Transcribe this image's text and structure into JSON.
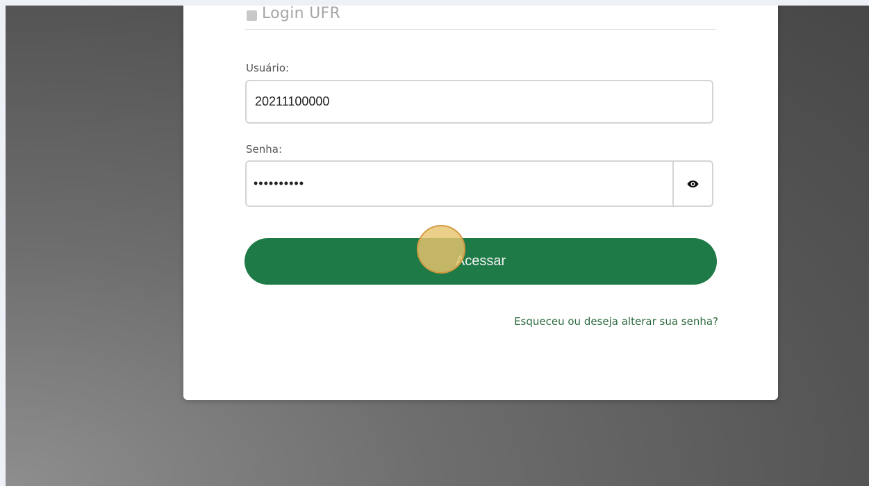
{
  "login_form": {
    "title": "Login UFR",
    "username_label": "Usuário:",
    "username_value": "20211100000",
    "password_label": "Senha:",
    "password_value": "••••••••••",
    "submit_label": "Acessar",
    "forgot_link": "Esqueceu ou deseja alterar sua senha?"
  },
  "icons": {
    "login_header": "user-icon",
    "password_toggle": "eye-icon"
  },
  "colors": {
    "primary_button": "#1e7a47",
    "link": "#2c6a3f",
    "click_marker": "#e8c46e"
  }
}
